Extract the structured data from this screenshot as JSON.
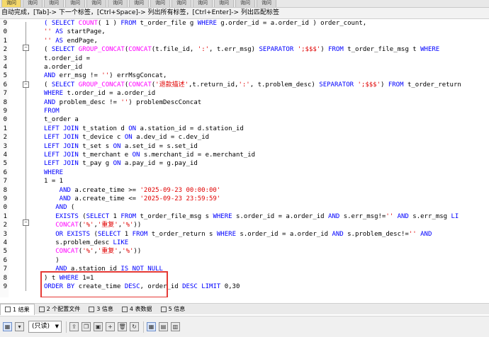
{
  "tabs": [
    "询问",
    "询问",
    "询问",
    "询问",
    "询问",
    "询问",
    "询问",
    "询问",
    "询问",
    "询问",
    "询问",
    "询问",
    "询问"
  ],
  "hint": "自动完成，[Tab]-> 下一个标签，[Ctrl+Space]-> 列出所有标签，[Ctrl+Enter]-> 列出匹配标签",
  "code_lines": [
    {
      "n": "9",
      "indent": 0,
      "t": [
        [
          "kw",
          "    ( SELECT "
        ],
        [
          "fn",
          "COUNT"
        ],
        [
          "",
          "( 1 ) "
        ],
        [
          "kw",
          "FROM"
        ],
        [
          "",
          " t_order_file g "
        ],
        [
          "kw",
          "WHERE"
        ],
        [
          "",
          " g.order_id = a.order_id ) order_count,"
        ]
      ]
    },
    {
      "n": "0",
      "indent": 0,
      "t": [
        [
          "str",
          "    ''"
        ],
        [
          "kw",
          " AS"
        ],
        [
          "",
          " startPage,"
        ]
      ]
    },
    {
      "n": "1",
      "indent": 0,
      "t": [
        [
          "str",
          "    ''"
        ],
        [
          "kw",
          " AS"
        ],
        [
          "",
          " endPage,"
        ]
      ]
    },
    {
      "n": "2",
      "indent": 0,
      "t": [
        [
          "",
          "    ( "
        ],
        [
          "kw",
          "SELECT "
        ],
        [
          "fn",
          "GROUP_CONCAT"
        ],
        [
          "",
          "("
        ],
        [
          "fn",
          "CONCAT"
        ],
        [
          "",
          "(t.file_id, "
        ],
        [
          "str",
          "':'"
        ],
        [
          "",
          ", t.err_msg) "
        ],
        [
          "kw",
          "SEPARATOR"
        ],
        [
          "",
          " "
        ],
        [
          "str",
          "';$$$'"
        ],
        [
          "",
          ") "
        ],
        [
          "kw",
          "FROM"
        ],
        [
          "",
          " t_order_file_msg t "
        ],
        [
          "kw",
          "WHERE"
        ]
      ]
    },
    {
      "n": "3",
      "indent": 0,
      "t": [
        [
          "",
          "    t.order_id ="
        ]
      ]
    },
    {
      "n": "4",
      "indent": 0,
      "t": [
        [
          "",
          "    a.order_id"
        ]
      ]
    },
    {
      "n": "5",
      "indent": 0,
      "t": [
        [
          "kw",
          "    AND"
        ],
        [
          "",
          " err_msg != "
        ],
        [
          "str",
          "''"
        ],
        [
          "",
          ") errMsgConcat,"
        ]
      ]
    },
    {
      "n": "6",
      "indent": 0,
      "t": [
        [
          "",
          "    ( "
        ],
        [
          "kw",
          "SELECT "
        ],
        [
          "fn",
          "GROUP_CONCAT"
        ],
        [
          "",
          "("
        ],
        [
          "fn",
          "CONCAT"
        ],
        [
          "",
          "("
        ],
        [
          "str",
          "'退款描述'"
        ],
        [
          "",
          ",t.return_id,"
        ],
        [
          "str",
          "':'"
        ],
        [
          "",
          ", t.problem_desc) "
        ],
        [
          "kw",
          "SEPARATOR"
        ],
        [
          "",
          " "
        ],
        [
          "str",
          "';$$$'"
        ],
        [
          "",
          ") "
        ],
        [
          "kw",
          "FROM"
        ],
        [
          "",
          " t_order_return"
        ]
      ]
    },
    {
      "n": "7",
      "indent": 0,
      "t": [
        [
          "kw",
          "    WHERE"
        ],
        [
          "",
          " t.order_id = a.order_id"
        ]
      ]
    },
    {
      "n": "8",
      "indent": 0,
      "t": [
        [
          "kw",
          "    AND"
        ],
        [
          "",
          " problem_desc != "
        ],
        [
          "str",
          "''"
        ],
        [
          "",
          ") problemDescConcat"
        ]
      ]
    },
    {
      "n": "9",
      "indent": 0,
      "t": [
        [
          "kw",
          "    FROM"
        ]
      ]
    },
    {
      "n": "0",
      "indent": 0,
      "t": [
        [
          "",
          "    t_order a"
        ]
      ]
    },
    {
      "n": "1",
      "indent": 0,
      "t": [
        [
          "kw",
          "    LEFT JOIN"
        ],
        [
          "",
          " t_station d "
        ],
        [
          "kw",
          "ON"
        ],
        [
          "",
          " a.station_id = d.station_id"
        ]
      ]
    },
    {
      "n": "2",
      "indent": 0,
      "t": [
        [
          "kw",
          "    LEFT JOIN"
        ],
        [
          "",
          " t_device c "
        ],
        [
          "kw",
          "ON"
        ],
        [
          "",
          " a.dev_id = c.dev_id"
        ]
      ]
    },
    {
      "n": "3",
      "indent": 0,
      "t": [
        [
          "kw",
          "    LEFT JOIN"
        ],
        [
          "",
          " t_set s "
        ],
        [
          "kw",
          "ON"
        ],
        [
          "",
          " a.set_id = s.set_id"
        ]
      ]
    },
    {
      "n": "4",
      "indent": 0,
      "t": [
        [
          "kw",
          "    LEFT JOIN"
        ],
        [
          "",
          " t_merchant e "
        ],
        [
          "kw",
          "ON"
        ],
        [
          "",
          " s.merchant_id = e.merchant_id"
        ]
      ]
    },
    {
      "n": "5",
      "indent": 0,
      "t": [
        [
          "kw",
          "    LEFT JOIN"
        ],
        [
          "",
          " t_pay g "
        ],
        [
          "kw",
          "ON"
        ],
        [
          "",
          " a.pay_id = g.pay_id"
        ]
      ]
    },
    {
      "n": "6",
      "indent": 0,
      "t": [
        [
          "kw",
          "    WHERE"
        ]
      ]
    },
    {
      "n": "7",
      "indent": 0,
      "t": [
        [
          "",
          "    1 = 1"
        ]
      ]
    },
    {
      "n": "8",
      "indent": 0,
      "t": [
        [
          "kw",
          "        AND"
        ],
        [
          "",
          " a.create_time >= "
        ],
        [
          "str",
          "'2025-09-23 00:00:00'"
        ]
      ]
    },
    {
      "n": "9",
      "indent": 0,
      "t": [
        [
          "kw",
          "        AND"
        ],
        [
          "",
          " a.create_time <= "
        ],
        [
          "str",
          "'2025-09-23 23:59:59'"
        ]
      ]
    },
    {
      "n": "0",
      "indent": 0,
      "t": [
        [
          "kw",
          "       AND"
        ],
        [
          "",
          " ("
        ]
      ]
    },
    {
      "n": "1",
      "indent": 0,
      "t": [
        [
          "kw",
          "       EXISTS"
        ],
        [
          "",
          " ("
        ],
        [
          "kw",
          "SELECT"
        ],
        [
          "",
          " 1 "
        ],
        [
          "kw",
          "FROM"
        ],
        [
          "",
          " t_order_file_msg s "
        ],
        [
          "kw",
          "WHERE"
        ],
        [
          "",
          " s.order_id = a.order_id "
        ],
        [
          "kw",
          "AND"
        ],
        [
          "",
          " s.err_msg!="
        ],
        [
          "str",
          "''"
        ],
        [
          "kw",
          " AND"
        ],
        [
          "",
          " s.err_msg "
        ],
        [
          "kw",
          "LI"
        ]
      ]
    },
    {
      "n": "2",
      "indent": 0,
      "t": [
        [
          "fn",
          "       CONCAT"
        ],
        [
          "",
          "("
        ],
        [
          "str",
          "'%'"
        ],
        [
          "",
          ","
        ],
        [
          "str",
          "'重复'"
        ],
        [
          "",
          ","
        ],
        [
          "str",
          "'%'"
        ],
        [
          "",
          "))"
        ]
      ]
    },
    {
      "n": "3",
      "indent": 0,
      "t": [
        [
          "kw",
          "       OR EXISTS"
        ],
        [
          "",
          " ("
        ],
        [
          "kw",
          "SELECT"
        ],
        [
          "",
          " 1 "
        ],
        [
          "kw",
          "FROM"
        ],
        [
          "",
          " t_order_return s "
        ],
        [
          "kw",
          "WHERE"
        ],
        [
          "",
          " s.order_id = a.order_id "
        ],
        [
          "kw",
          "AND"
        ],
        [
          "",
          " s.problem_desc!="
        ],
        [
          "str",
          "''"
        ],
        [
          "kw",
          " AND"
        ]
      ]
    },
    {
      "n": "4",
      "indent": 0,
      "t": [
        [
          "",
          "       s.problem_desc "
        ],
        [
          "kw",
          "LIKE"
        ]
      ]
    },
    {
      "n": "5",
      "indent": 0,
      "t": [
        [
          "fn",
          "       CONCAT"
        ],
        [
          "",
          "("
        ],
        [
          "str",
          "'%'"
        ],
        [
          "",
          ","
        ],
        [
          "str",
          "'重复'"
        ],
        [
          "",
          ","
        ],
        [
          "str",
          "'%'"
        ],
        [
          "",
          "))"
        ]
      ]
    },
    {
      "n": "6",
      "indent": 0,
      "t": [
        [
          "",
          "       )"
        ]
      ]
    },
    {
      "n": "7",
      "indent": 0,
      "t": [
        [
          "kw",
          "       AND"
        ],
        [
          "",
          " a.station_id "
        ],
        [
          "kw",
          "IS NOT NULL"
        ]
      ]
    },
    {
      "n": "8",
      "indent": 0,
      "t": [
        [
          "",
          "    ) t "
        ],
        [
          "kw",
          "WHERE"
        ],
        [
          "",
          " 1=1"
        ]
      ]
    },
    {
      "n": "9",
      "indent": 0,
      "t": [
        [
          "kw",
          "    ORDER BY"
        ],
        [
          "",
          " create_time "
        ],
        [
          "kw",
          "DESC"
        ],
        [
          "",
          ", order_id "
        ],
        [
          "kw",
          "DESC LIMIT"
        ],
        [
          "",
          " 0,30"
        ]
      ]
    }
  ],
  "results_tabs": [
    {
      "label": "1 结果",
      "active": true
    },
    {
      "label": "2 个配置文件",
      "active": false
    },
    {
      "label": "3 信息",
      "active": false
    },
    {
      "label": "4 表数据",
      "active": false
    },
    {
      "label": "5 信息",
      "active": false
    }
  ],
  "toolbar": {
    "mode_select": "(只读)"
  },
  "colors": {
    "keyword": "#0000ff",
    "function": "#ff00ff",
    "string": "#e00000",
    "highlight_box": "#e53935",
    "active_tab": "#f4d86a"
  }
}
